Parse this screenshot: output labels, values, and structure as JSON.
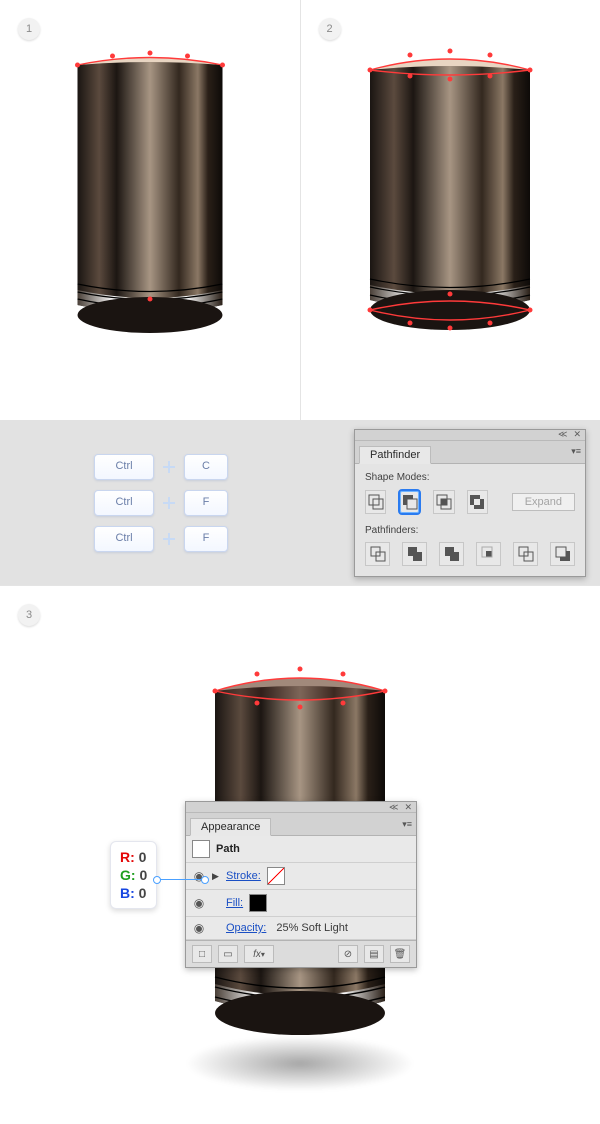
{
  "steps": {
    "s1": "1",
    "s2": "2",
    "s3": "3"
  },
  "shortcuts": [
    {
      "mod": "Ctrl",
      "key": "C"
    },
    {
      "mod": "Ctrl",
      "key": "F"
    },
    {
      "mod": "Ctrl",
      "key": "F"
    }
  ],
  "pathfinder": {
    "tab": "Pathfinder",
    "shape_modes_label": "Shape Modes:",
    "pathfinders_label": "Pathfinders:",
    "expand": "Expand",
    "shape_modes": [
      {
        "name": "unite-icon",
        "selected": false
      },
      {
        "name": "minus-front-icon",
        "selected": true
      },
      {
        "name": "intersect-icon",
        "selected": false
      },
      {
        "name": "exclude-icon",
        "selected": false
      }
    ],
    "pathfinders": [
      {
        "name": "divide-icon"
      },
      {
        "name": "trim-icon"
      },
      {
        "name": "merge-icon"
      },
      {
        "name": "crop-icon"
      },
      {
        "name": "outline-icon"
      },
      {
        "name": "minus-back-icon"
      }
    ]
  },
  "appearance": {
    "tab": "Appearance",
    "path_label": "Path",
    "stroke_label": "Stroke:",
    "fill_label": "Fill:",
    "opacity_label": "Opacity:",
    "opacity_value": "25% Soft Light",
    "fx_label": "fx"
  },
  "rgb": {
    "r_key": "R:",
    "r_val": "0",
    "g_key": "G:",
    "g_val": "0",
    "b_key": "B:",
    "b_val": "0"
  }
}
